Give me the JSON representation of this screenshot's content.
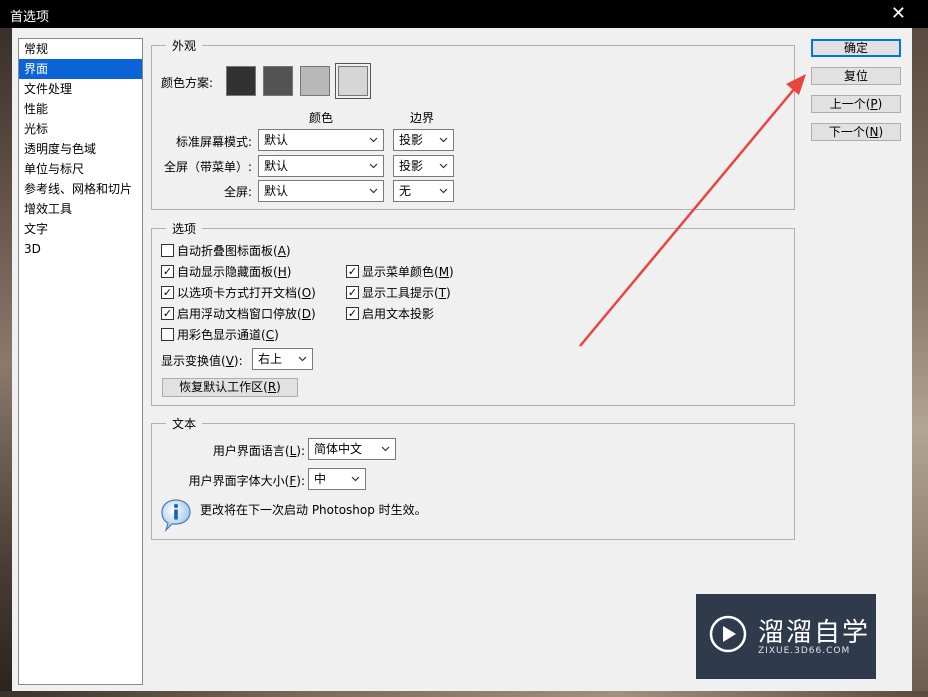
{
  "window": {
    "title": "首选项",
    "close_glyph": "✕"
  },
  "sidebar": {
    "items": [
      {
        "label": "常规",
        "selected": false
      },
      {
        "label": "界面",
        "selected": true
      },
      {
        "label": "文件处理",
        "selected": false
      },
      {
        "label": "性能",
        "selected": false
      },
      {
        "label": "光标",
        "selected": false
      },
      {
        "label": "透明度与色域",
        "selected": false
      },
      {
        "label": "单位与标尺",
        "selected": false
      },
      {
        "label": "参考线、网格和切片",
        "selected": false
      },
      {
        "label": "增效工具",
        "selected": false
      },
      {
        "label": "文字",
        "selected": false
      },
      {
        "label": "3D",
        "selected": false
      }
    ]
  },
  "appearance": {
    "legend": "外观",
    "color_scheme_label": "颜色方案:",
    "swatches": [
      {
        "color": "#323232",
        "selected": false
      },
      {
        "color": "#535353",
        "selected": false
      },
      {
        "color": "#b8b8b8",
        "selected": false
      },
      {
        "color": "#d6d6d6",
        "selected": true
      }
    ],
    "col_color": "颜色",
    "col_border": "边界",
    "rows": [
      {
        "label": "标准屏幕模式:",
        "color": "默认",
        "border": "投影"
      },
      {
        "label": "全屏（带菜单）:",
        "color": "默认",
        "border": "投影"
      },
      {
        "label": "全屏:",
        "color": "默认",
        "border": "无"
      }
    ]
  },
  "options": {
    "legend": "选项",
    "checkboxes": [
      {
        "label": "自动折叠图标面板(",
        "key": "A",
        "checked": false
      },
      {
        "label": "自动显示隐藏面板(",
        "key": "H",
        "checked": true
      },
      {
        "label": "以选项卡方式打开文档(",
        "key": "O",
        "checked": true
      },
      {
        "label": "启用浮动文档窗口停放(",
        "key": "D",
        "checked": true
      },
      {
        "label": "用彩色显示通道(",
        "key": "C",
        "checked": false
      },
      {
        "label": "显示菜单颜色(",
        "key": "M",
        "checked": true
      },
      {
        "label": "显示工具提示(",
        "key": "T",
        "checked": true
      },
      {
        "label": "启用文本投影",
        "key": "",
        "checked": true
      }
    ],
    "transform_label": "显示变换值(",
    "transform_key": "V",
    "transform_value": "右上",
    "reset_workspace_label": "恢复默认工作区(",
    "reset_workspace_key": "R"
  },
  "text_group": {
    "legend": "文本",
    "ui_language_label": "用户界面语言(",
    "ui_language_key": "L",
    "ui_language_value": "简体中文",
    "ui_font_size_label": "用户界面字体大小(",
    "ui_font_size_key": "F",
    "ui_font_size_value": "中",
    "info_text": "更改将在下一次启动 Photoshop 时生效。",
    "info_icon": "info-icon"
  },
  "buttons": {
    "ok": "确定",
    "reset": "复位",
    "prev_label": "上一个(",
    "prev_key": "P",
    "next_label": "下一个(",
    "next_key": "N"
  },
  "annotation": {
    "arrow_color": "#e8453c"
  },
  "watermark": {
    "title": "溜溜自学",
    "subtitle": "ZIXUE.3D66.COM",
    "bg_color": "#2f3b4d"
  }
}
